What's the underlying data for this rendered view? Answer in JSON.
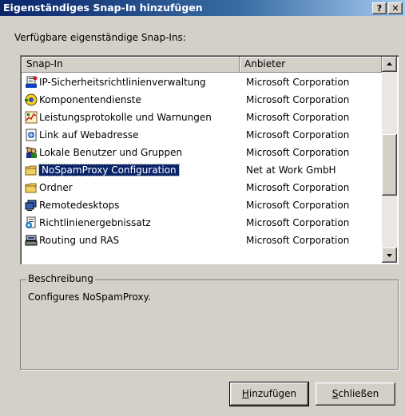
{
  "dialog": {
    "title": "Eigenständiges Snap-In hinzufügen",
    "help_button": "?",
    "close_button": "✕"
  },
  "available_label": "Verfügbare eigenständige Snap-Ins:",
  "list": {
    "columns": [
      "Snap-In",
      "Anbieter"
    ],
    "selected_index": 5,
    "rows": [
      {
        "name": "IP-Sicherheitsrichtlinienverwaltung",
        "vendor": "Microsoft Corporation",
        "icon": "security-policy-icon"
      },
      {
        "name": "Komponentendienste",
        "vendor": "Microsoft Corporation",
        "icon": "component-services-icon"
      },
      {
        "name": "Leistungsprotokolle und Warnungen",
        "vendor": "Microsoft Corporation",
        "icon": "performance-logs-icon"
      },
      {
        "name": "Link auf Webadresse",
        "vendor": "Microsoft Corporation",
        "icon": "web-link-icon"
      },
      {
        "name": "Lokale Benutzer und Gruppen",
        "vendor": "Microsoft Corporation",
        "icon": "users-groups-icon"
      },
      {
        "name": "NoSpamProxy Configuration",
        "vendor": "Net at Work GmbH",
        "icon": "folder-icon"
      },
      {
        "name": "Ordner",
        "vendor": "Microsoft Corporation",
        "icon": "folder-icon"
      },
      {
        "name": "Remotedesktops",
        "vendor": "Microsoft Corporation",
        "icon": "remote-desktops-icon"
      },
      {
        "name": "Richtlinienergebnissatz",
        "vendor": "Microsoft Corporation",
        "icon": "policy-results-icon"
      },
      {
        "name": "Routing und RAS",
        "vendor": "Microsoft Corporation",
        "icon": "routing-ras-icon"
      }
    ]
  },
  "description": {
    "legend": "Beschreibung",
    "text": "Configures NoSpamProxy."
  },
  "buttons": {
    "add": {
      "prefix": "",
      "accel": "H",
      "rest": "inzufügen"
    },
    "close": {
      "prefix": "",
      "accel": "S",
      "rest": "chließen"
    }
  },
  "colors": {
    "title_gradient_start": "#0a246a",
    "selection": "#0a246a",
    "face": "#d4d0c8"
  }
}
